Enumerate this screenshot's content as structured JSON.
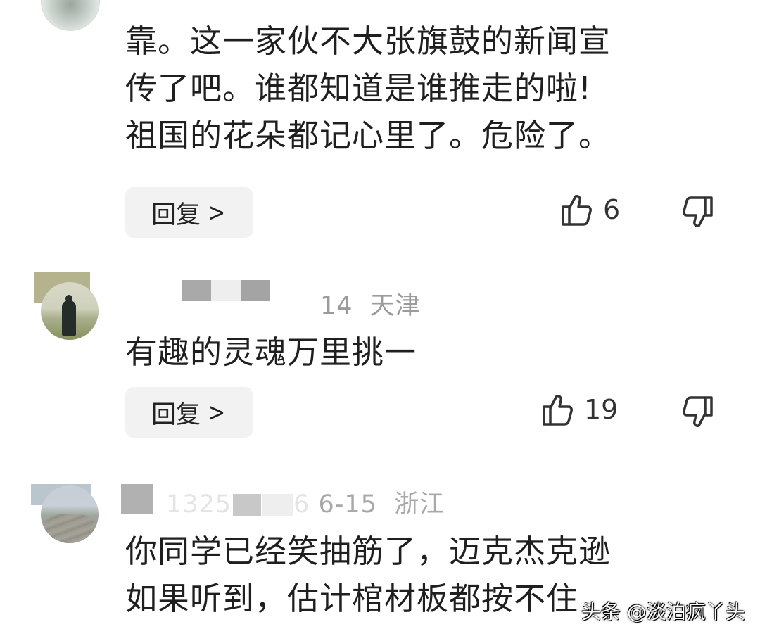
{
  "comments": [
    {
      "text": "靠。这一家伙不大张旗鼓的新闻宣\n传了吧。谁都知道是谁推走的啦!\n祖国的花朵都记心里了。危险了。",
      "reply_label": "回复",
      "reply_chevron": ">",
      "likes": "6"
    },
    {
      "meta": "14  天津",
      "text": "有趣的灵魂万里挑一",
      "reply_label": "回复",
      "reply_chevron": ">",
      "likes": "19"
    },
    {
      "meta_faded": "1325",
      "meta_digit": "6",
      "meta": "6-15  浙江",
      "text": "你同学已经笑抽筋了，迈克杰克逊\n如果听到，估计棺材板都按不住"
    }
  ],
  "watermark": "头条 @淡泊疯丫头",
  "icons": {
    "like": "thumbs-up-icon",
    "dislike": "thumbs-down-icon",
    "chevron": "chevron-right-icon"
  },
  "colors": {
    "text": "#1f1f1f",
    "meta": "#9b9b9b",
    "reply_bg": "#f2f2f2"
  }
}
